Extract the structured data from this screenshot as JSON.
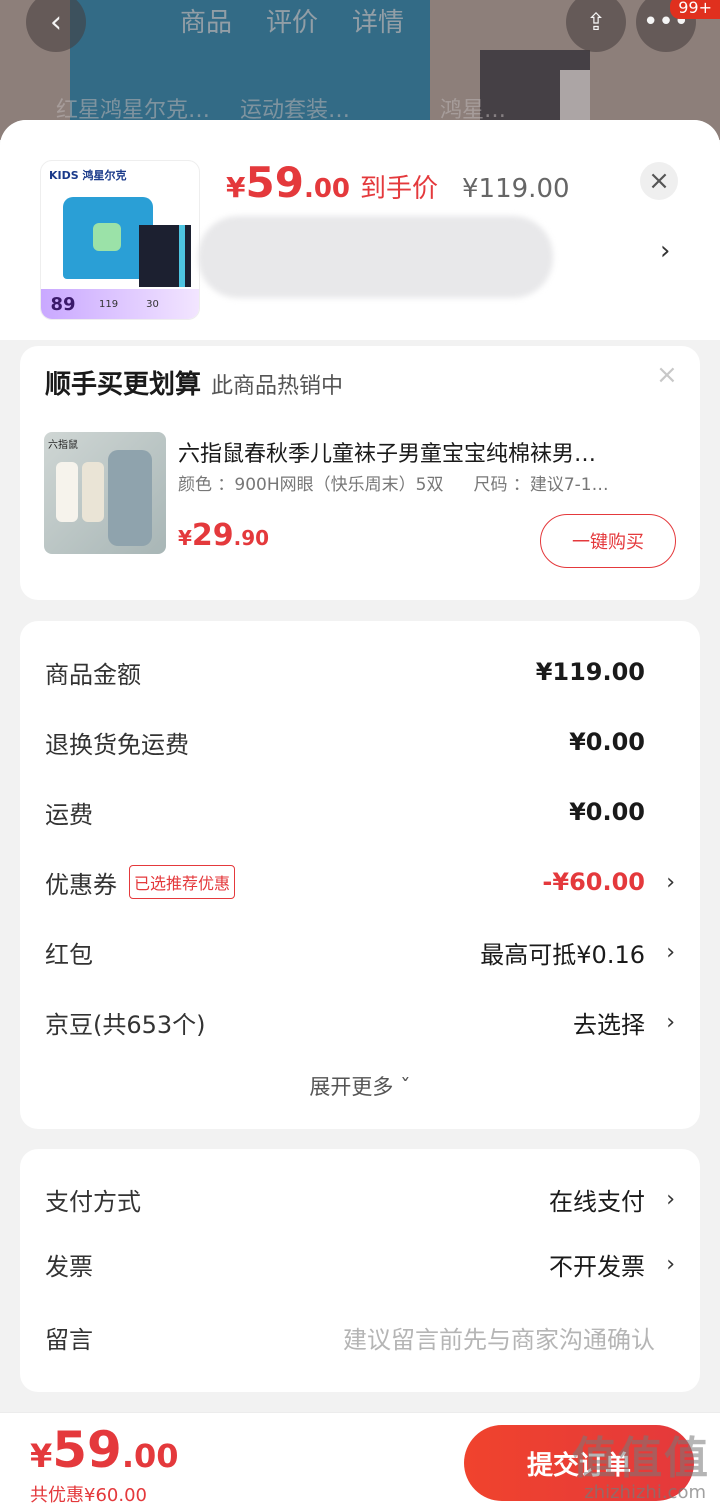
{
  "background": {
    "tabs": [
      "商品",
      "评价",
      "详情"
    ],
    "sub_left": "红星鸿星尔克…",
    "sub_mid": "运动套装…",
    "sub_right": "鸿星…",
    "badge": "99+",
    "back_icon": "chevron-left-icon",
    "share_icon": "share-icon",
    "more_icon": "more-icon"
  },
  "product": {
    "price_symbol": "¥",
    "price_int": "59",
    "price_dec": ".00",
    "price_tag": "到手价",
    "original_price": "¥119.00",
    "thumb_brand": "KIDS 鸿星尔克",
    "thumb_price_big": "89",
    "thumb_price_a": "119",
    "thumb_price_b": "30",
    "close_icon": "close-icon",
    "arrow_icon": "chevron-right-icon"
  },
  "addon": {
    "title": "顺手买更划算",
    "subtitle": "此商品热销中",
    "item_brand": "六指鼠",
    "item_name": "六指鼠春秋季儿童袜子男童宝宝纯棉袜男…",
    "item_color": "颜色 ：900H网眼（快乐周末）5双",
    "item_size": "尺码 ：建议7-1…",
    "price_symbol": "¥",
    "price_int": "29",
    "price_dec": ".90",
    "buy_label": "一键购买"
  },
  "cost": {
    "rows": [
      {
        "label": "商品金额",
        "value": "¥119.00"
      },
      {
        "label": "退换货免运费",
        "value": "¥0.00"
      },
      {
        "label": "运费",
        "value": "¥0.00"
      },
      {
        "label": "优惠券",
        "badge": "已选推荐优惠",
        "value": "-¥60.00"
      },
      {
        "label": "红包",
        "value": "最高可抵¥0.16"
      },
      {
        "label": "京豆(共653个)",
        "value": "去选择"
      }
    ],
    "expand_label": "展开更多 ˇ"
  },
  "payment": {
    "rows": [
      {
        "label": "支付方式",
        "value": "在线支付"
      },
      {
        "label": "发票",
        "value": "不开发票"
      },
      {
        "label": "留言",
        "placeholder": "建议留言前先与商家沟通确认"
      }
    ]
  },
  "footer": {
    "price_symbol": "¥",
    "price_int": "59",
    "price_dec": ".00",
    "saved": "共优惠¥60.00",
    "submit_label": "提交订单",
    "watermark_title": "值值值",
    "watermark_url": "zhizhizhi.com"
  },
  "colors": {
    "accent": "#e4393c"
  }
}
